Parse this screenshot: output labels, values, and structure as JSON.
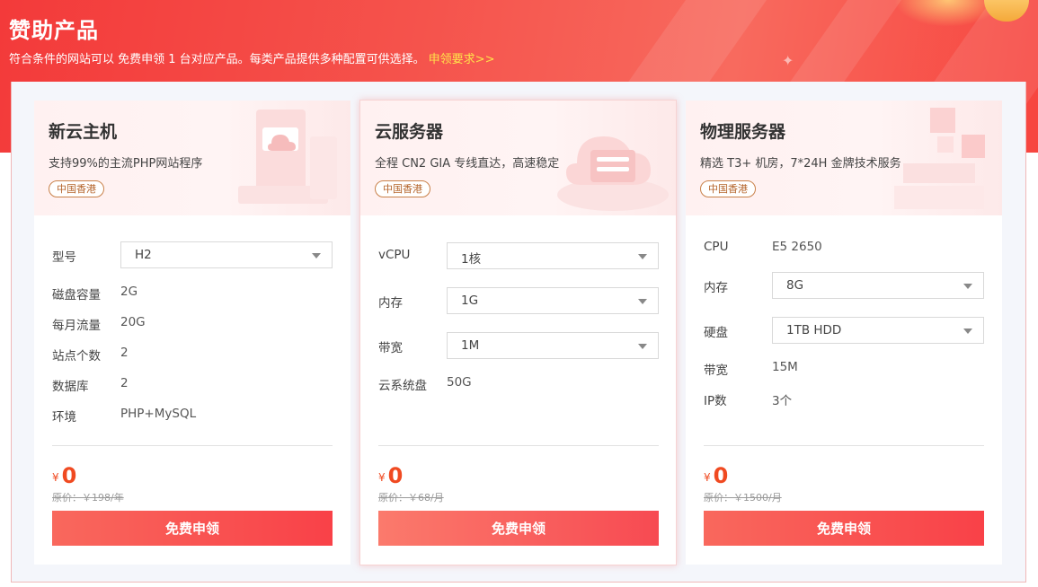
{
  "banner": {
    "title": "赞助产品",
    "description": "符合条件的网站可以 免费申领 1 台对应产品。每类产品提供多种配置可供选择。",
    "link": "申领要求>>"
  },
  "colors": {
    "accent": "#f94148",
    "price": "#f04a21",
    "link": "#ffe24a"
  },
  "cards": [
    {
      "title": "新云主机",
      "subtitle": "支持99%的主流PHP网站程序",
      "region": "中国香港",
      "specs": {
        "model_label": "型号",
        "model_value": "H2",
        "disk_label": "磁盘容量",
        "disk_value": "2G",
        "traffic_label": "每月流量",
        "traffic_value": "20G",
        "sites_label": "站点个数",
        "sites_value": "2",
        "db_label": "数据库",
        "db_value": "2",
        "env_label": "环境",
        "env_value": "PHP+MySQL"
      },
      "currency": "¥",
      "price": "0",
      "original_price": "原价：￥198/年",
      "button": "免费申领"
    },
    {
      "title": "云服务器",
      "subtitle": "全程 CN2 GIA 专线直达，高速稳定",
      "region": "中国香港",
      "specs": {
        "vcpu_label": "vCPU",
        "vcpu_value": "1核",
        "mem_label": "内存",
        "mem_value": "1G",
        "bw_label": "带宽",
        "bw_value": "1M",
        "sysdisk_label": "云系统盘",
        "sysdisk_value": "50G"
      },
      "currency": "¥",
      "price": "0",
      "original_price": "原价：￥68/月",
      "button": "免费申领"
    },
    {
      "title": "物理服务器",
      "subtitle": "精选 T3+ 机房，7*24H 金牌技术服务",
      "region": "中国香港",
      "specs": {
        "cpu_label": "CPU",
        "cpu_value": "E5 2650",
        "mem_label": "内存",
        "mem_value": "8G",
        "disk_label": "硬盘",
        "disk_value": "1TB HDD",
        "bw_label": "带宽",
        "bw_value": "15M",
        "ip_label": "IP数",
        "ip_value": "3个"
      },
      "currency": "¥",
      "price": "0",
      "original_price": "原价：￥1500/月",
      "button": "免费申领"
    }
  ]
}
